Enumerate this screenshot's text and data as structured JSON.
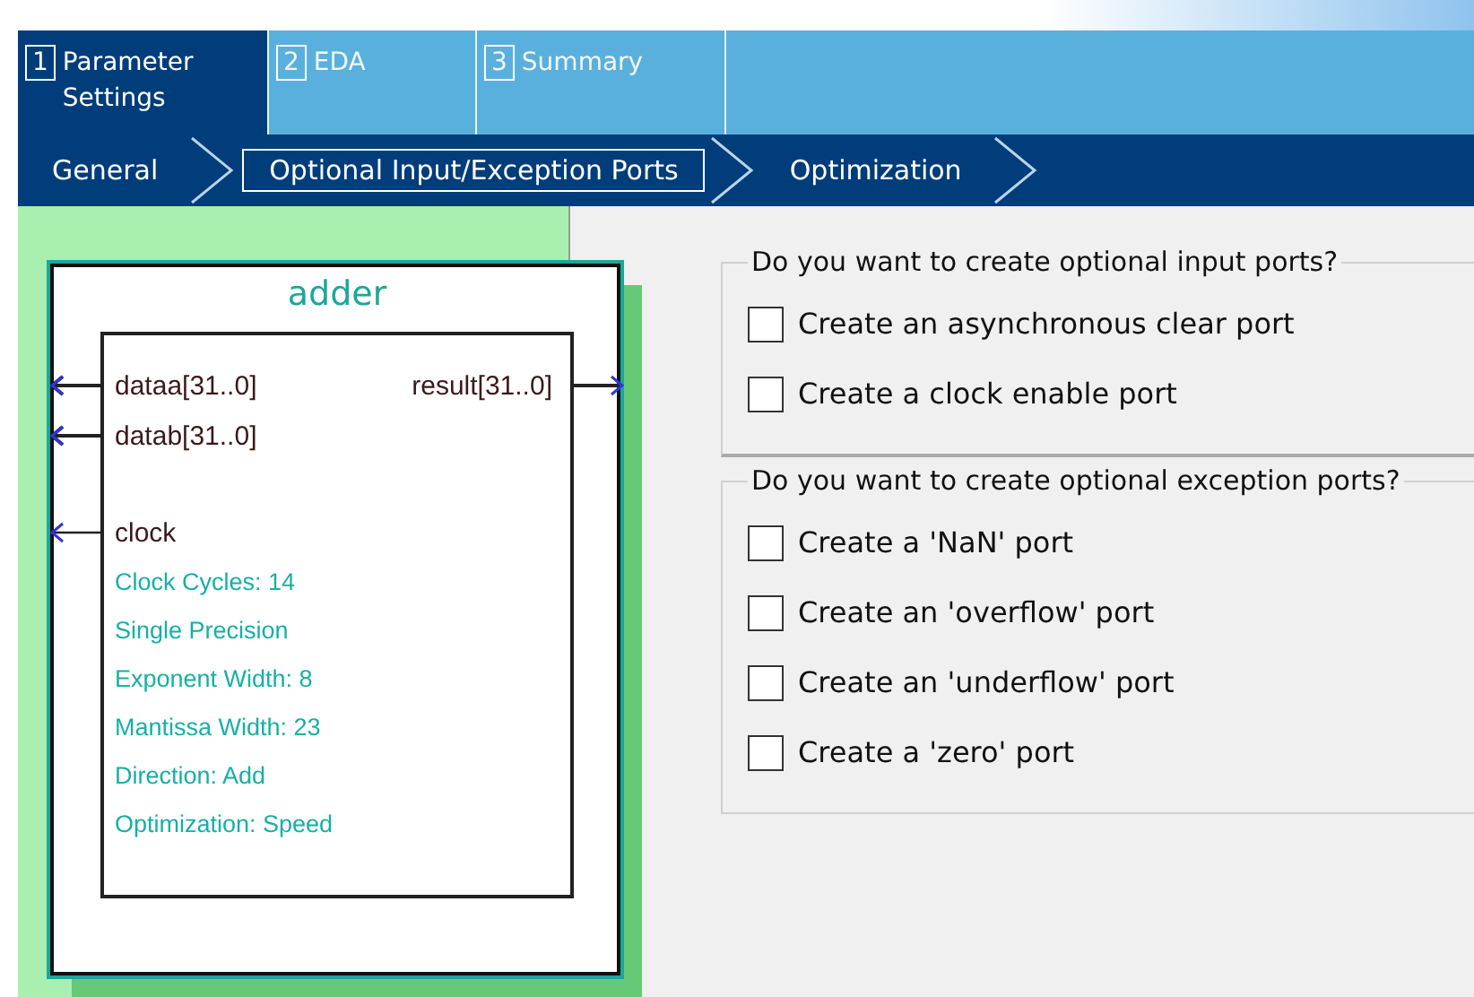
{
  "tabs": [
    {
      "number": "1",
      "label": "Parameter Settings",
      "selected": true
    },
    {
      "number": "2",
      "label": "EDA",
      "selected": false
    },
    {
      "number": "3",
      "label": "Summary",
      "selected": false
    }
  ],
  "steps": [
    {
      "label": "General",
      "selected": false
    },
    {
      "label": "Optional Input/Exception Ports",
      "selected": true
    },
    {
      "label": "Optimization",
      "selected": false
    }
  ],
  "symbol": {
    "title": "adder",
    "left_ports": [
      "dataa[31..0]",
      "datab[31..0]"
    ],
    "right_ports": [
      "result[31..0]"
    ],
    "clock": "clock",
    "params": [
      "Clock Cycles: 14",
      "Single Precision",
      "Exponent Width: 8",
      "Mantissa Width: 23",
      "Direction: Add",
      "Optimization: Speed"
    ]
  },
  "groups": [
    {
      "title": "Do you want to create optional input ports?",
      "options": [
        {
          "label": "Create an asynchronous clear port",
          "checked": false
        },
        {
          "label": "Create a clock enable port",
          "checked": false
        }
      ]
    },
    {
      "title": "Do you want to create optional exception ports?",
      "options": [
        {
          "label": "Create a 'NaN' port",
          "checked": false
        },
        {
          "label": "Create an 'overflow' port",
          "checked": false
        },
        {
          "label": "Create an 'underflow' port",
          "checked": false
        },
        {
          "label": "Create a 'zero' port",
          "checked": false
        }
      ]
    }
  ]
}
